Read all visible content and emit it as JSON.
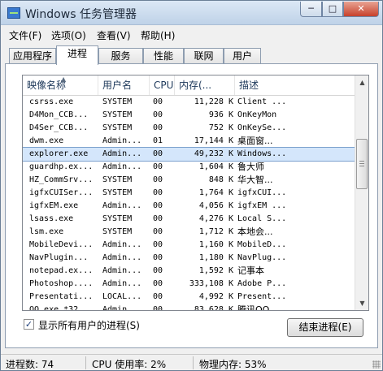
{
  "window": {
    "title": "Windows 任务管理器",
    "min": "─",
    "max": "□",
    "close": "✕"
  },
  "menu": [
    "文件(F)",
    "选项(O)",
    "查看(V)",
    "帮助(H)"
  ],
  "tabs": [
    "应用程序",
    "进程",
    "服务",
    "性能",
    "联网",
    "用户"
  ],
  "active_tab": "进程",
  "columns": [
    "映像名称",
    "用户名",
    "CPU",
    "内存(...",
    "描述"
  ],
  "sort_indicator": "▲",
  "processes": [
    {
      "name": "csrss.exe",
      "user": "SYSTEM",
      "cpu": "00",
      "mem": "11,228 K",
      "desc": "Client ..."
    },
    {
      "name": "D4Mon_CCB...",
      "user": "SYSTEM",
      "cpu": "00",
      "mem": "936 K",
      "desc": "OnKeyMon"
    },
    {
      "name": "D4Ser_CCB...",
      "user": "SYSTEM",
      "cpu": "00",
      "mem": "752 K",
      "desc": "OnKeySe..."
    },
    {
      "name": "dwm.exe",
      "user": "Admin...",
      "cpu": "01",
      "mem": "17,144 K",
      "desc": "桌面窗..."
    },
    {
      "name": "explorer.exe",
      "user": "Admin...",
      "cpu": "00",
      "mem": "49,232 K",
      "desc": "Windows..."
    },
    {
      "name": "guardhp.ex...",
      "user": "Admin...",
      "cpu": "00",
      "mem": "1,604 K",
      "desc": "鲁大师"
    },
    {
      "name": "HZ_CommSrv...",
      "user": "SYSTEM",
      "cpu": "00",
      "mem": "848 K",
      "desc": "华大智..."
    },
    {
      "name": "igfxCUISer...",
      "user": "SYSTEM",
      "cpu": "00",
      "mem": "1,764 K",
      "desc": "igfxCUI..."
    },
    {
      "name": "igfxEM.exe",
      "user": "Admin...",
      "cpu": "00",
      "mem": "4,056 K",
      "desc": "igfxEM ..."
    },
    {
      "name": "lsass.exe",
      "user": "SYSTEM",
      "cpu": "00",
      "mem": "4,276 K",
      "desc": "Local S..."
    },
    {
      "name": "lsm.exe",
      "user": "SYSTEM",
      "cpu": "00",
      "mem": "1,712 K",
      "desc": "本地会..."
    },
    {
      "name": "MobileDevi...",
      "user": "Admin...",
      "cpu": "00",
      "mem": "1,160 K",
      "desc": "MobileD..."
    },
    {
      "name": "NavPlugin...",
      "user": "Admin...",
      "cpu": "00",
      "mem": "1,180 K",
      "desc": "NavPlug..."
    },
    {
      "name": "notepad.ex...",
      "user": "Admin...",
      "cpu": "00",
      "mem": "1,592 K",
      "desc": "记事本"
    },
    {
      "name": "Photoshop....",
      "user": "Admin...",
      "cpu": "00",
      "mem": "333,108 K",
      "desc": "Adobe P..."
    },
    {
      "name": "Presentati...",
      "user": "LOCAL...",
      "cpu": "00",
      "mem": "4,992 K",
      "desc": "Present..."
    },
    {
      "name": "QQ.exe *32",
      "user": "Admin...",
      "cpu": "00",
      "mem": "83,628 K",
      "desc": "腾讯QQ"
    }
  ],
  "selected_index": 4,
  "scrollbar": {
    "up": "▲",
    "down": "▼"
  },
  "show_all_users": {
    "checked": true,
    "mark": "✓",
    "label": "显示所有用户的进程(S)"
  },
  "end_process_button": "结束进程(E)",
  "status": {
    "processes": "进程数: 74",
    "cpu": "CPU 使用率: 2%",
    "memory": "物理内存: 53%"
  }
}
